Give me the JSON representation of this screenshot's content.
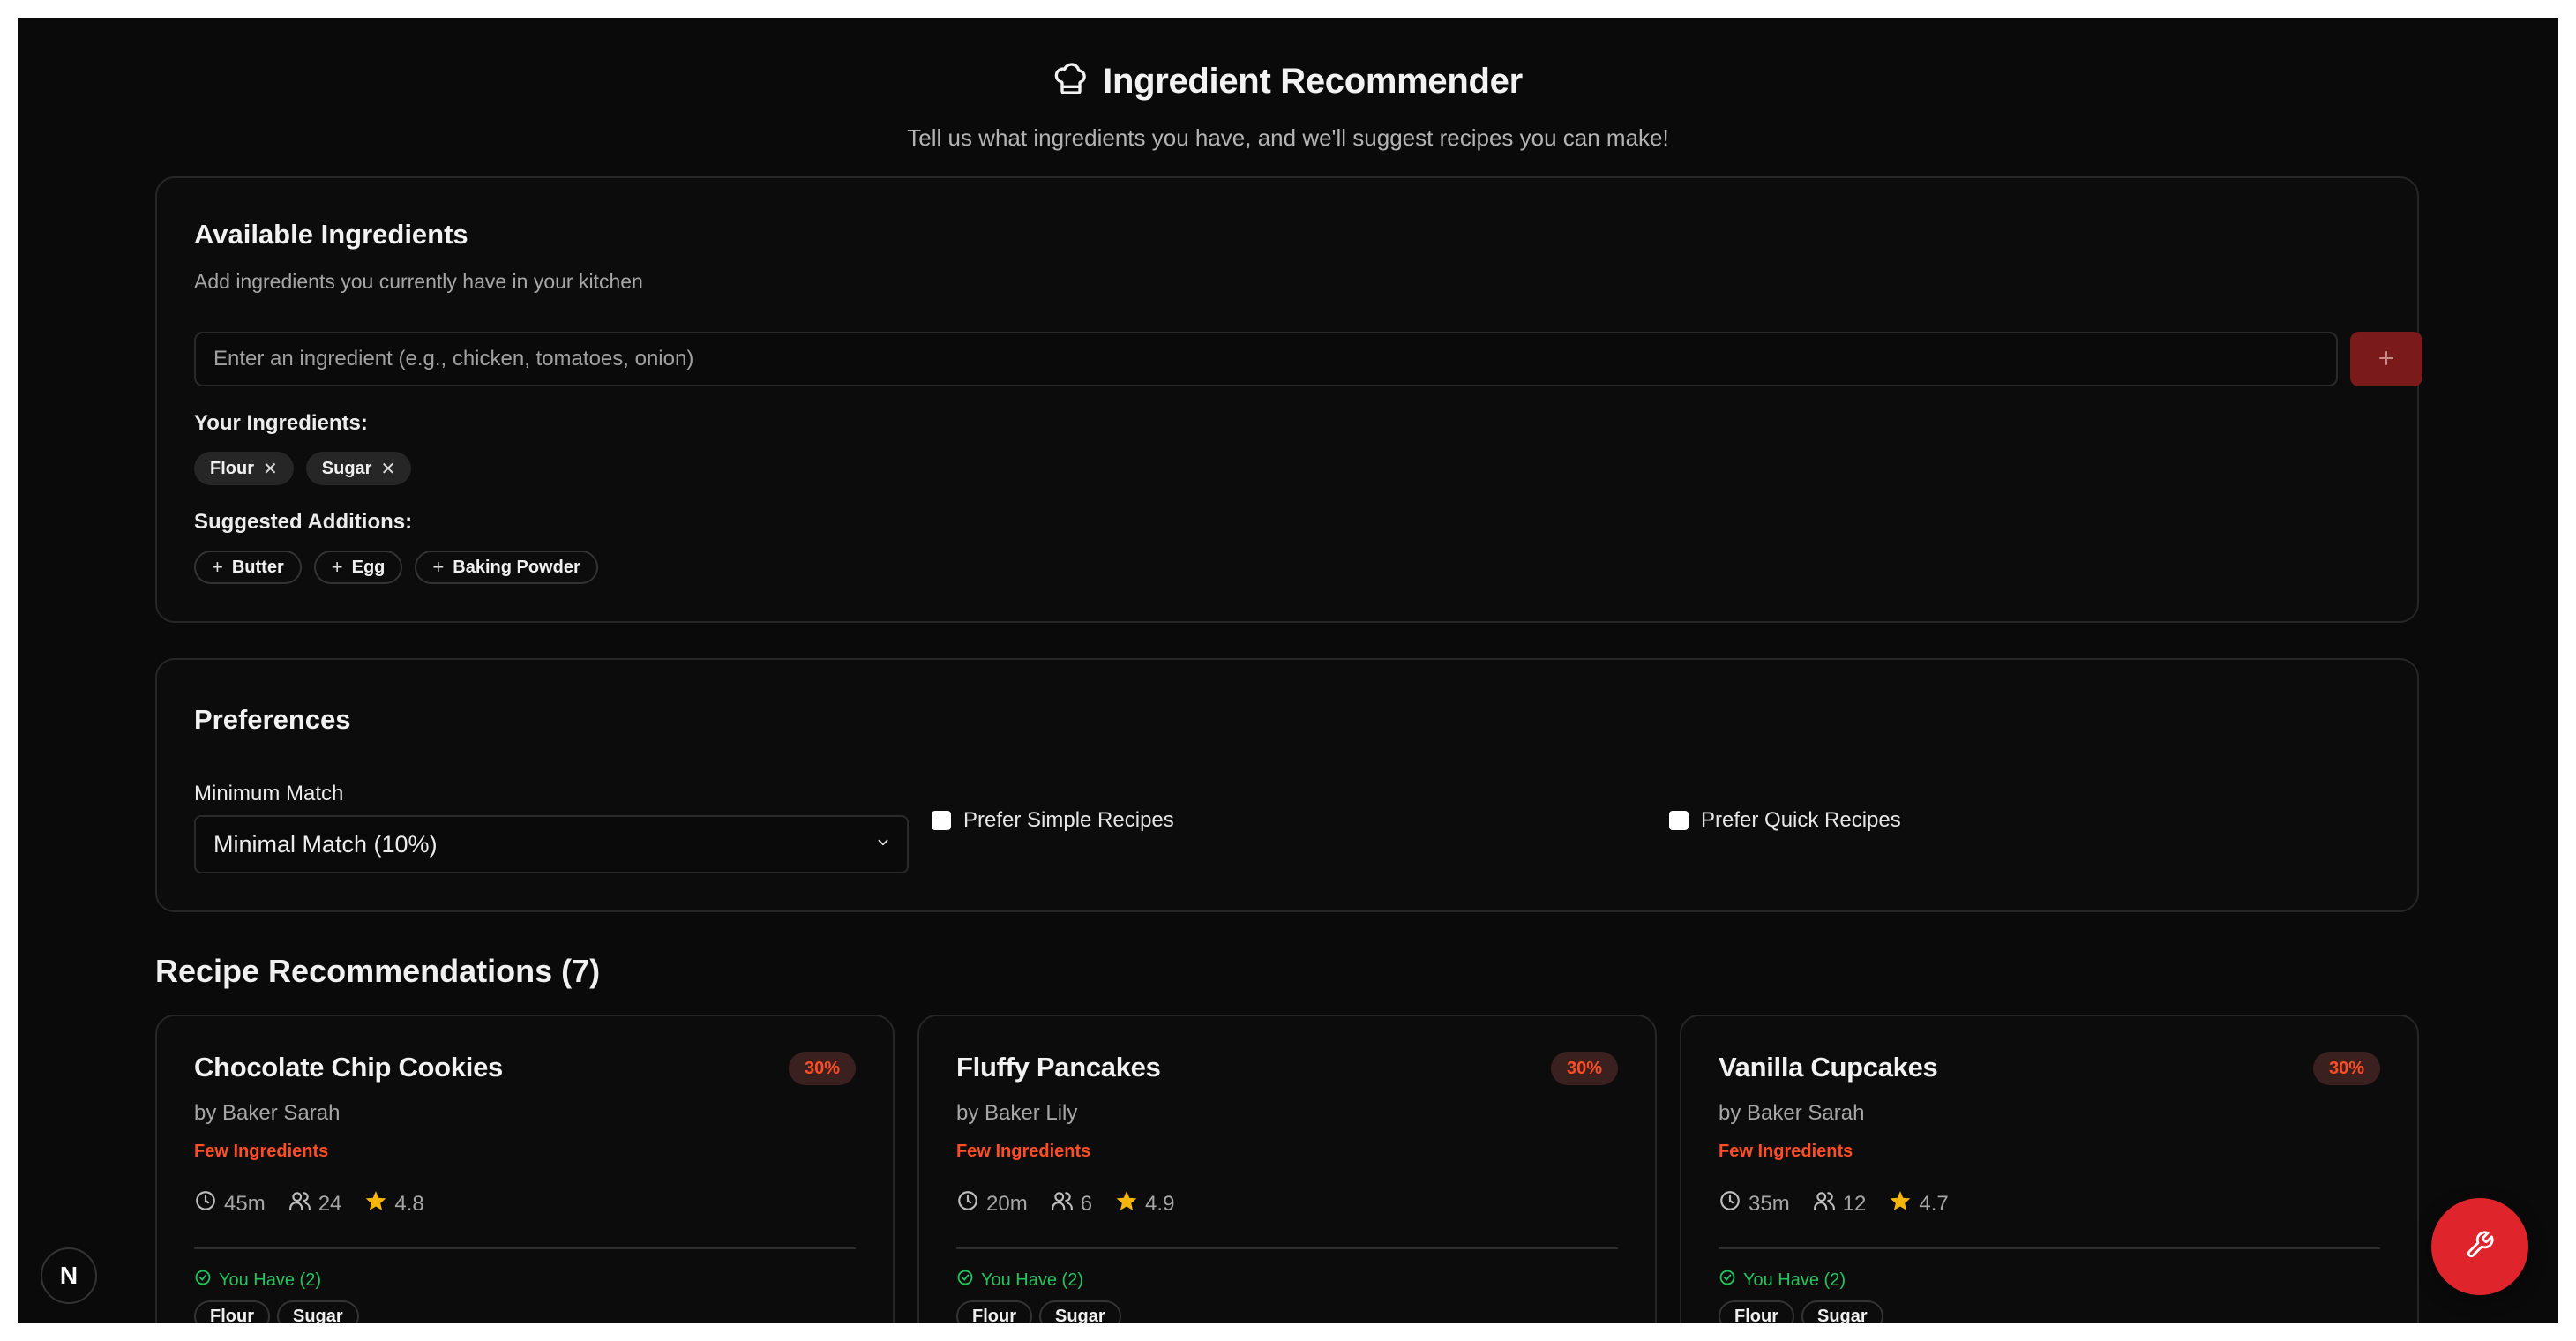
{
  "header": {
    "title": "Ingredient Recommender",
    "subtitle": "Tell us what ingredients you have, and we'll suggest recipes you can make!"
  },
  "ingredients": {
    "title": "Available Ingredients",
    "description": "Add ingredients you currently have in your kitchen",
    "input_placeholder": "Enter an ingredient (e.g., chicken, tomatoes, onion)",
    "add_label": "+",
    "yours_label": "Your Ingredients:",
    "yours": [
      "Flour",
      "Sugar"
    ],
    "suggested_label": "Suggested Additions:",
    "suggested": [
      "Butter",
      "Egg",
      "Baking Powder"
    ]
  },
  "preferences": {
    "title": "Preferences",
    "min_match_label": "Minimum Match",
    "min_match_value": "Minimal Match (10%)",
    "simple_label": "Prefer Simple Recipes",
    "quick_label": "Prefer Quick Recipes"
  },
  "recommendations": {
    "heading": "Recipe Recommendations (7)",
    "have_label": "You Have (2)",
    "recipes": [
      {
        "title": "Chocolate Chip Cookies",
        "match": "30%",
        "author": "by Baker Sarah",
        "tag": "Few Ingredients",
        "time": "45m",
        "servings": "24",
        "rating": "4.8",
        "have": [
          "Flour",
          "Sugar"
        ]
      },
      {
        "title": "Fluffy Pancakes",
        "match": "30%",
        "author": "by Baker Lily",
        "tag": "Few Ingredients",
        "time": "20m",
        "servings": "6",
        "rating": "4.9",
        "have": [
          "Flour",
          "Sugar"
        ]
      },
      {
        "title": "Vanilla Cupcakes",
        "match": "30%",
        "author": "by Baker Sarah",
        "tag": "Few Ingredients",
        "time": "35m",
        "servings": "12",
        "rating": "4.7",
        "have": [
          "Flour",
          "Sugar"
        ]
      }
    ]
  },
  "misc": {
    "next_badge": "N",
    "fab_icon": "wrench-icon",
    "accent_color": "#ff4d24",
    "success_color": "#22c55e"
  }
}
